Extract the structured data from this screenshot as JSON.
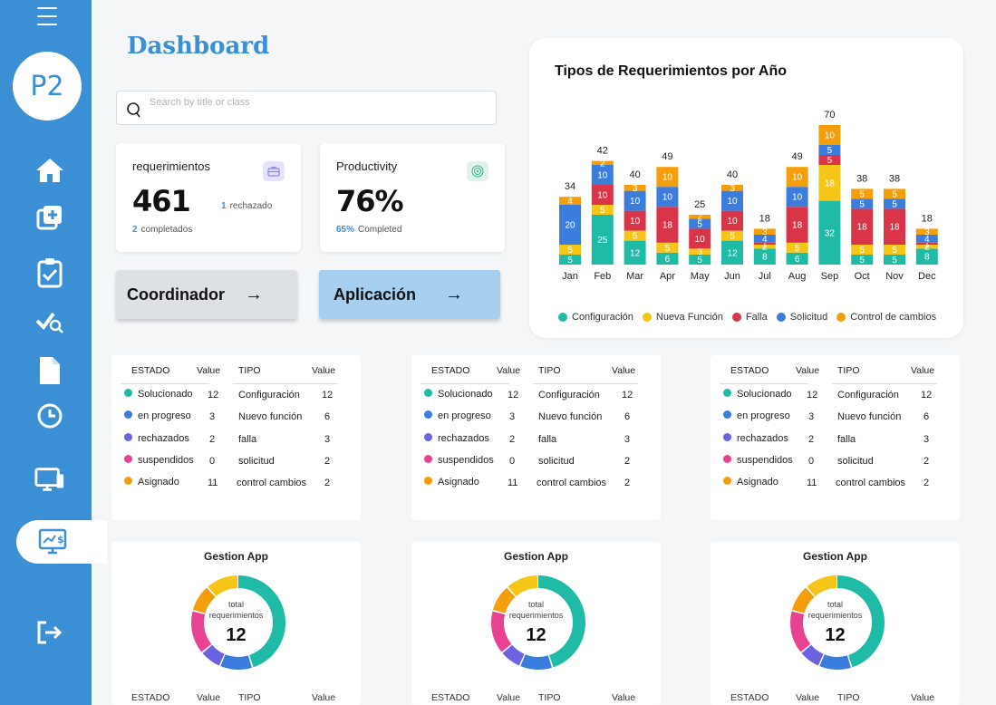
{
  "sidebar": {
    "avatar": "P2",
    "icons": [
      "home-icon",
      "add-card-icon",
      "clipboard-check-icon",
      "check-search-icon",
      "document-icon",
      "clock-icon",
      "monitor-icon",
      "monitor-dollar-icon",
      "logout-icon"
    ]
  },
  "page": {
    "title": "Dashboard",
    "search_placeholder": "Search by title or class"
  },
  "cards": {
    "requerimientos": {
      "label": "requerimientos",
      "value": "461",
      "rejected_count": "1",
      "rejected_label": "rechazado",
      "completed_count": "2",
      "completed_label": "completados"
    },
    "productivity": {
      "label": "Productivity",
      "value": "76%",
      "pct": "65%",
      "pct_label": "Completed"
    }
  },
  "buttons": {
    "coordinador": "Coordinador",
    "aplicacion": "Aplicación"
  },
  "colors": {
    "accent": "#3a8fd5",
    "teal": "#1fbba6",
    "yellow": "#f5c518",
    "red": "#d93448",
    "blue": "#3b7ddd",
    "orange": "#f59e0b",
    "pink": "#e84393",
    "purple": "#6c63e0"
  },
  "chart_data": {
    "type": "bar",
    "title": "Tipos de Requerimientos  por  Año",
    "categories": [
      "Jan",
      "Feb",
      "Mar",
      "Apr",
      "May",
      "Jun",
      "Jul",
      "Aug",
      "Sep",
      "Oct",
      "Nov",
      "Dec"
    ],
    "series": [
      {
        "name": "Configuración",
        "color": "#1fbba6",
        "values": [
          5,
          25,
          12,
          6,
          5,
          12,
          8,
          6,
          32,
          5,
          5,
          8
        ]
      },
      {
        "name": "Nueva Función",
        "color": "#f5c518",
        "values": [
          5,
          5,
          5,
          5,
          3,
          5,
          2,
          5,
          18,
          5,
          5,
          2
        ]
      },
      {
        "name": "Falla",
        "color": "#d93448",
        "values": [
          0,
          10,
          10,
          18,
          10,
          10,
          1,
          18,
          5,
          18,
          18,
          1
        ]
      },
      {
        "name": "Solicitud",
        "color": "#3b7ddd",
        "values": [
          20,
          10,
          10,
          10,
          5,
          10,
          4,
          10,
          5,
          5,
          5,
          4
        ]
      },
      {
        "name": "Control de cambios",
        "color": "#f59e0b",
        "values": [
          4,
          2,
          3,
          10,
          2,
          3,
          3,
          10,
          10,
          5,
          5,
          3
        ]
      }
    ],
    "totals": [
      34,
      42,
      40,
      49,
      25,
      40,
      18,
      49,
      70,
      38,
      38,
      18
    ]
  },
  "status_table": {
    "headers": {
      "estado": "ESTADO",
      "value": "Value",
      "tipo": "TIPO",
      "value2": "Value"
    },
    "estado_rows": [
      {
        "label": "Solucionado",
        "value": "12",
        "color": "#1fbba6"
      },
      {
        "label": "en progreso",
        "value": "3",
        "color": "#3b7ddd"
      },
      {
        "label": "rechazados",
        "value": "2",
        "color": "#6c63e0"
      },
      {
        "label": "suspendidos",
        "value": "0",
        "color": "#e84393"
      },
      {
        "label": "Asignado",
        "value": "11",
        "color": "#f59e0b"
      }
    ],
    "tipo_rows": [
      {
        "label": "Configuración",
        "value": "12"
      },
      {
        "label": "Nuevo función",
        "value": "6"
      },
      {
        "label": "falla",
        "value": "3"
      },
      {
        "label": "solicitud",
        "value": "2"
      },
      {
        "label": "control cambios",
        "value": "2"
      }
    ]
  },
  "donut": {
    "title": "Gestion App",
    "center_label_1": "total",
    "center_label_2": "requerimientos",
    "center_value": "12",
    "segments": [
      {
        "color": "#1fbba6",
        "value": 12
      },
      {
        "color": "#3b7ddd",
        "value": 3
      },
      {
        "color": "#6c63e0",
        "value": 2
      },
      {
        "color": "#e84393",
        "value": 4
      },
      {
        "color": "#f59e0b",
        "value": 2.5
      },
      {
        "color": "#f5c518",
        "value": 3
      }
    ]
  }
}
